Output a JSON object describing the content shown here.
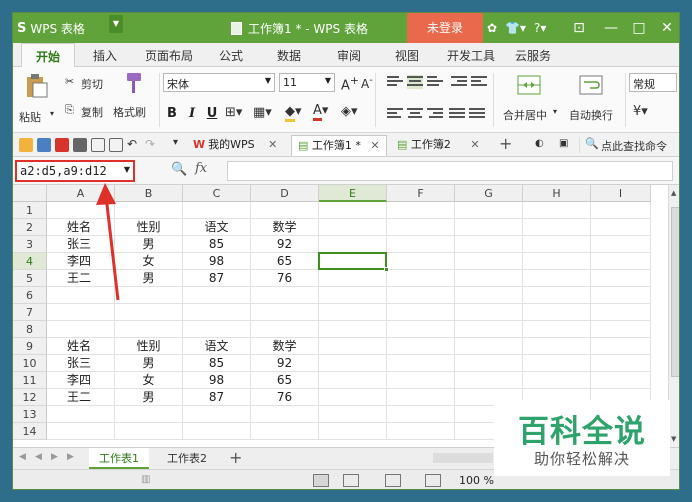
{
  "app": {
    "logo": "S",
    "name": "WPS 表格",
    "doc_title": "工作簿1 * - WPS 表格",
    "login": "未登录"
  },
  "ribbon_tabs": [
    "开始",
    "插入",
    "页面布局",
    "公式",
    "数据",
    "审阅",
    "视图",
    "开发工具",
    "云服务"
  ],
  "ribbon": {
    "paste": "粘贴",
    "cut": "剪切",
    "copy": "复制",
    "format_painter": "格式刷",
    "font_name": "宋体",
    "font_size": "11",
    "bold": "B",
    "italic": "I",
    "underline": "U",
    "merge": "合并居中",
    "wrap": "自动换行",
    "number_format": "常规"
  },
  "doc_tabs": {
    "wps": "我的WPS",
    "book1": "工作簿1 *",
    "book2": "工作簿2",
    "search": "点此查找命令"
  },
  "formula_bar": {
    "name_box": "a2:d5,a9:d12",
    "fx": "fx",
    "formula": ""
  },
  "grid": {
    "columns": [
      "A",
      "B",
      "C",
      "D",
      "E",
      "F",
      "G",
      "H",
      "I"
    ],
    "rows": [
      "1",
      "2",
      "3",
      "4",
      "5",
      "6",
      "7",
      "8",
      "9",
      "10",
      "11",
      "12",
      "13",
      "14"
    ],
    "cells": {
      "A2": "姓名",
      "B2": "性别",
      "C2": "语文",
      "D2": "数学",
      "A3": "张三",
      "B3": "男",
      "C3": "85",
      "D3": "92",
      "A4": "李四",
      "B4": "女",
      "C4": "98",
      "D4": "65",
      "A5": "王二",
      "B5": "男",
      "C5": "87",
      "D5": "76",
      "A9": "姓名",
      "B9": "性别",
      "C9": "语文",
      "D9": "数学",
      "A10": "张三",
      "B10": "男",
      "C10": "85",
      "D10": "92",
      "A11": "李四",
      "B11": "女",
      "C11": "98",
      "D11": "65",
      "A12": "王二",
      "B12": "男",
      "C12": "87",
      "D12": "76"
    },
    "active_cell": "E4"
  },
  "sheets": [
    "工作表1",
    "工作表2"
  ],
  "status": {
    "zoom": "100 %"
  },
  "watermark": {
    "title": "百科全说",
    "subtitle": "助你轻松解决"
  },
  "colors": {
    "title_green": "#5fa33a",
    "login_orange": "#e8694b",
    "annotation_red": "#e0302a",
    "watermark_green": "#2ea36b"
  }
}
